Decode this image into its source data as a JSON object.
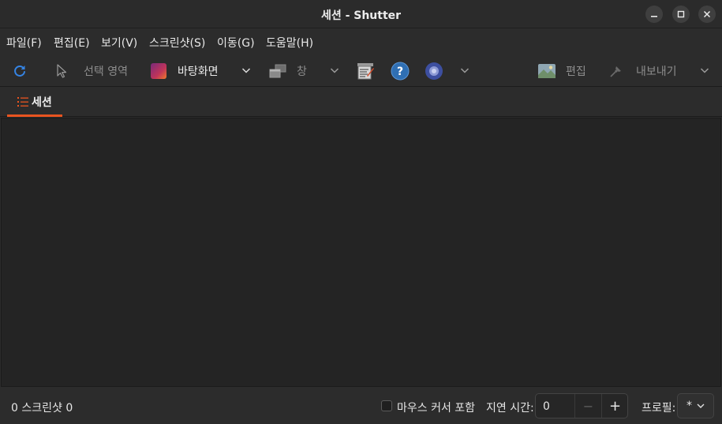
{
  "window": {
    "title": "세션 - Shutter"
  },
  "window_controls": {
    "minimize_icon": "minimize-icon",
    "maximize_icon": "maximize-icon",
    "close_icon": "close-icon"
  },
  "menu": [
    "파일(F)",
    "편집(E)",
    "보기(V)",
    "스크린샷(S)",
    "이동(G)",
    "도움말(H)"
  ],
  "toolbar": {
    "refresh_icon": "refresh-icon",
    "selection_label": "선택 영역",
    "desktop_label": "바탕화면",
    "window_label": "창",
    "edit_label": "편집",
    "export_label": "내보내기"
  },
  "tab": {
    "label": "세션"
  },
  "status": {
    "screenshot_count": "0 스크린샷 0",
    "include_cursor_label": "마우스 커서 포함",
    "include_cursor_checked": false,
    "delay_label": "지연 시간:",
    "delay_value": "0",
    "delay_minus": "−",
    "delay_plus": "+",
    "profile_label": "프로필:",
    "profile_value": "*"
  },
  "colors": {
    "accent": "#e95420",
    "link_blue": "#3584e4",
    "background": "#2c2c2c",
    "content": "#242424"
  }
}
